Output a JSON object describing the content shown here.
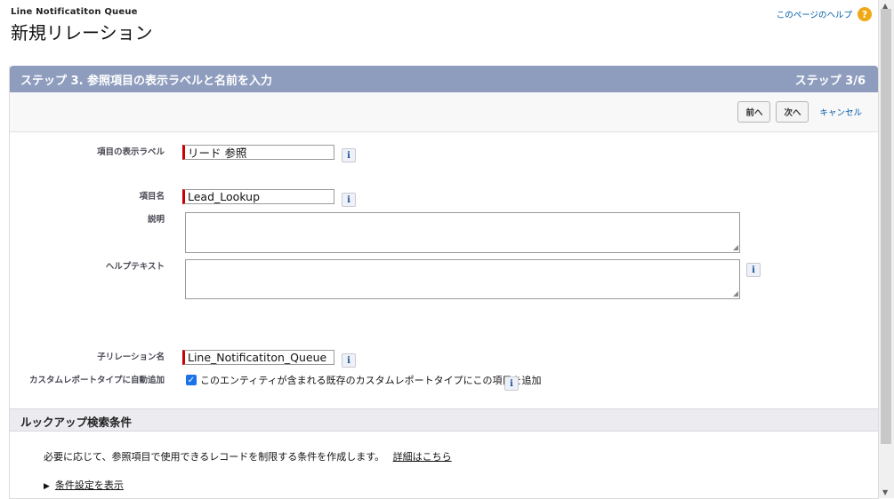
{
  "header": {
    "object_name": "Line Notificatiton Queue",
    "page_title": "新規リレーション",
    "help_link": "このページのヘルプ",
    "help_icon": "question-icon"
  },
  "step": {
    "title": "ステップ 3. 参照項目の表示ラベルと名前を入力",
    "counter": "ステップ 3/6"
  },
  "toolbar": {
    "prev_label": "前へ",
    "next_label": "次へ",
    "cancel_label": "キャンセル"
  },
  "form": {
    "field_label": {
      "label": "項目の表示ラベル",
      "value": "リード 参照"
    },
    "field_name": {
      "label": "項目名",
      "value": "Lead_Lookup"
    },
    "description": {
      "label": "説明",
      "value": ""
    },
    "help_text": {
      "label": "ヘルプテキスト",
      "value": ""
    },
    "child_relation": {
      "label": "子リレーション名",
      "value": "Line_Notificatiton_Queue"
    },
    "custom_report": {
      "label": "カスタムレポートタイプに自動追加",
      "checkbox_label": "このエンティティが含まれる既存のカスタムレポートタイプにこの項目を追加",
      "checked": true
    },
    "info_icon_text": "i"
  },
  "lookup_filter": {
    "section_title": "ルックアップ検索条件",
    "description": "必要に応じて、参照項目で使用できるレコードを制限する条件を作成します。",
    "details_link": "詳細はこちら",
    "toggle_label": "条件設定を表示"
  },
  "colors": {
    "step_header_bg": "#8e9dbe",
    "required_marker": "#cc0000",
    "link": "#015ba7",
    "checkbox": "#1a73e8"
  }
}
